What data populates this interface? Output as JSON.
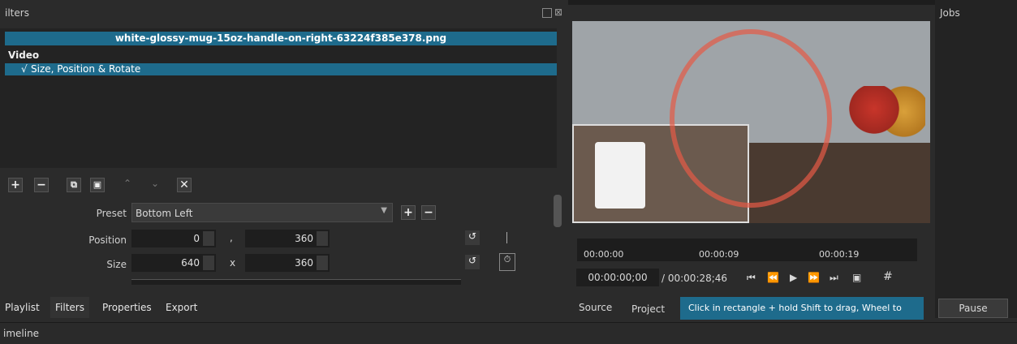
{
  "filters": {
    "panel_title": "ilters",
    "file_name": "white-glossy-mug-15oz-handle-on-right-63224f385e378.png",
    "video_heading": "Video",
    "filter_item": {
      "check": "√",
      "label": "Size, Position & Rotate"
    },
    "preset": {
      "label": "Preset",
      "value": "Bottom Left"
    },
    "position": {
      "label": "Position",
      "x": "0",
      "sep": ",",
      "y": "360"
    },
    "size": {
      "label": "Size",
      "w": "640",
      "sep": "x",
      "h": "360"
    }
  },
  "tabs": [
    {
      "label": "Playlist"
    },
    {
      "label": "Filters"
    },
    {
      "label": "Properties"
    },
    {
      "label": "Export"
    }
  ],
  "timeline": {
    "label": "imeline"
  },
  "viewer": {
    "ruler": {
      "t0": "00:00:00",
      "t1": "00:00:09",
      "t2": "00:00:19"
    },
    "timecode": "00:00:00;00",
    "duration": "/ 00:00:28;46",
    "source_tab": "Source",
    "project_tab": "Project",
    "hint": "Click in rectangle + hold Shift to drag, Wheel to zoo..."
  },
  "jobs": {
    "title": "Jobs",
    "pause_label": "Pause"
  },
  "colors": {
    "accent": "#1e6b8c",
    "panel": "#2b2b2b",
    "field": "#1e1e1e"
  }
}
